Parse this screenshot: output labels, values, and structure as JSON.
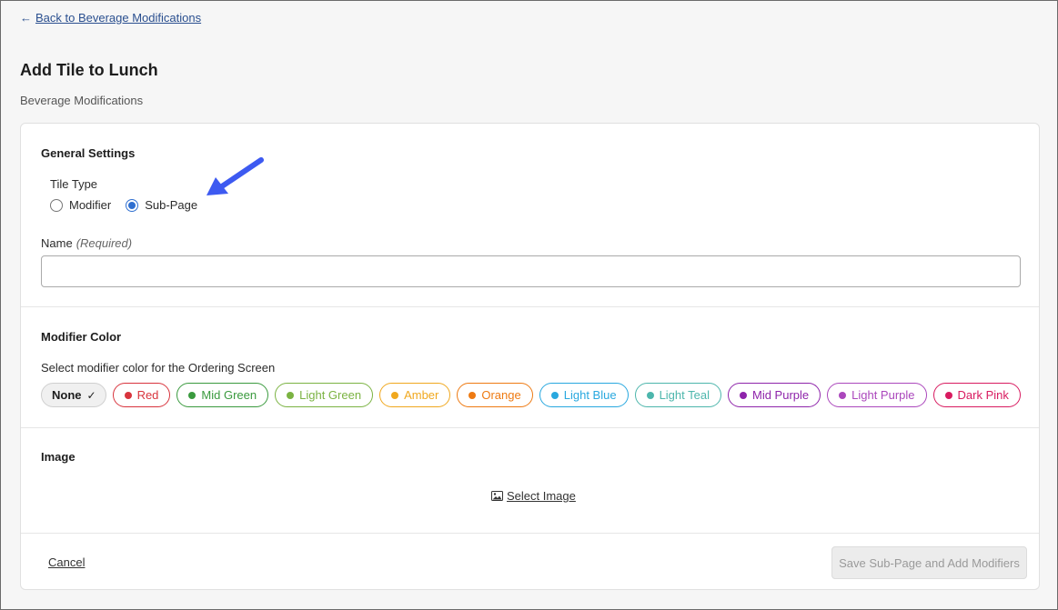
{
  "nav": {
    "back_label": "Back to Beverage Modifications"
  },
  "page": {
    "title": "Add Tile to Lunch",
    "subtitle": "Beverage Modifications"
  },
  "general": {
    "title": "General Settings",
    "tile_type_label": "Tile Type",
    "options": [
      {
        "label": "Modifier",
        "checked": false
      },
      {
        "label": "Sub-Page",
        "checked": true
      }
    ],
    "name_label": "Name",
    "name_required": "(Required)",
    "name_value": ""
  },
  "modifier_color": {
    "title": "Modifier Color",
    "description": "Select modifier color for the Ordering Screen",
    "none_label": "None",
    "colors": [
      {
        "label": "Red",
        "color": "#d8343d"
      },
      {
        "label": "Mid Green",
        "color": "#3a9a3e"
      },
      {
        "label": "Light Green",
        "color": "#7bb342"
      },
      {
        "label": "Amber",
        "color": "#f0a81f"
      },
      {
        "label": "Orange",
        "color": "#ee7a12"
      },
      {
        "label": "Light Blue",
        "color": "#29a8df"
      },
      {
        "label": "Light Teal",
        "color": "#4db6ac"
      },
      {
        "label": "Mid Purple",
        "color": "#8e24aa"
      },
      {
        "label": "Light Purple",
        "color": "#ab47bc"
      },
      {
        "label": "Dark Pink",
        "color": "#d81b60"
      }
    ]
  },
  "image": {
    "title": "Image",
    "select_label": "Select Image"
  },
  "footer": {
    "cancel_label": "Cancel",
    "save_label": "Save Sub-Page and Add Modifiers"
  },
  "annotation": {
    "arrow_color": "#3d5af1"
  }
}
